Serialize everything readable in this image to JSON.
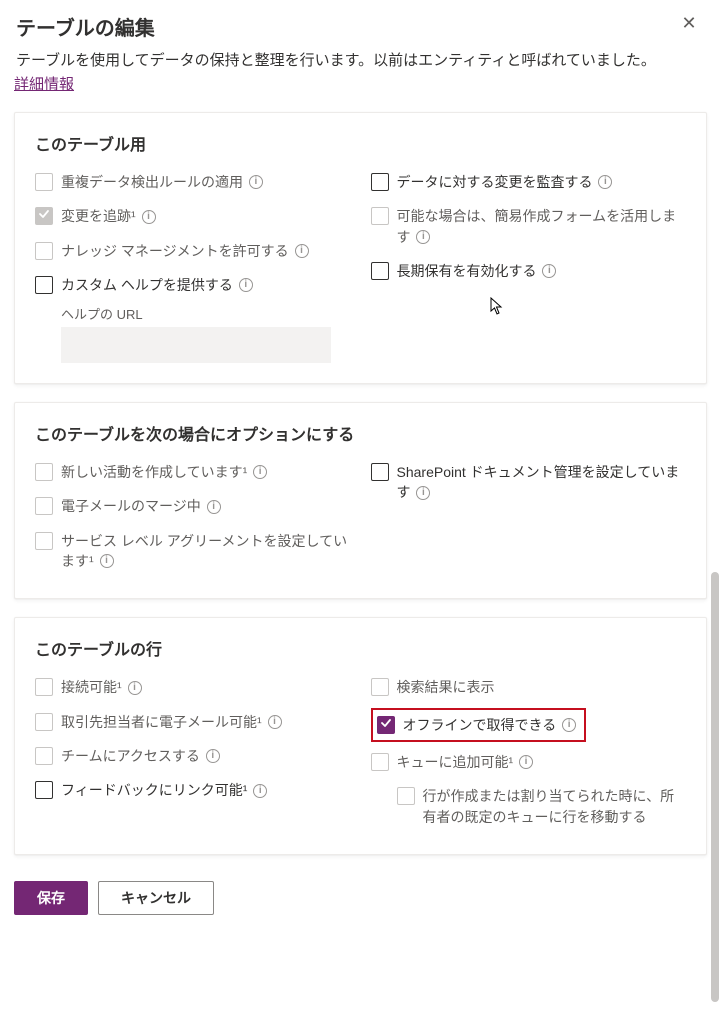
{
  "header": {
    "title": "テーブルの編集",
    "description": "テーブルを使用してデータの保持と整理を行います。以前はエンティティと呼ばれていました。",
    "more_info": "詳細情報"
  },
  "sections": {
    "s1": {
      "title": "このテーブル用",
      "left": {
        "dup_rules": "重複データ検出ルールの適用",
        "track_changes": "変更を追跡",
        "knowledge_mgmt": "ナレッジ マネージメントを許可する",
        "custom_help": "カスタム ヘルプを提供する",
        "help_url_label": "ヘルプの URL"
      },
      "right": {
        "audit": "データに対する変更を監査する",
        "quick_create": "可能な場合は、簡易作成フォームを活用します",
        "long_term": "長期保有を有効化する"
      }
    },
    "s2": {
      "title": "このテーブルを次の場合にオプションにする",
      "left": {
        "new_activity": "新しい活動を作成しています",
        "mail_merge": "電子メールのマージ中",
        "sla": "サービス レベル アグリーメントを設定しています"
      },
      "right": {
        "sharepoint": "SharePoint ドキュメント管理を設定しています"
      }
    },
    "s3": {
      "title": "このテーブルの行",
      "left": {
        "connect": "接続可能",
        "email_contact": "取引先担当者に電子メール可能",
        "access_team": "チームにアクセスする",
        "feedback": "フィードバックにリンク可能"
      },
      "right": {
        "search": "検索結果に表示",
        "offline": "オフラインで取得できる",
        "queue": "キューに追加可能",
        "queue_sub": "行が作成または割り当てられた時に、所有者の既定のキューに行を移動する"
      }
    }
  },
  "footer": {
    "save": "保存",
    "cancel": "キャンセル"
  },
  "marks": {
    "sup1": "¹",
    "info_glyph": "i"
  }
}
